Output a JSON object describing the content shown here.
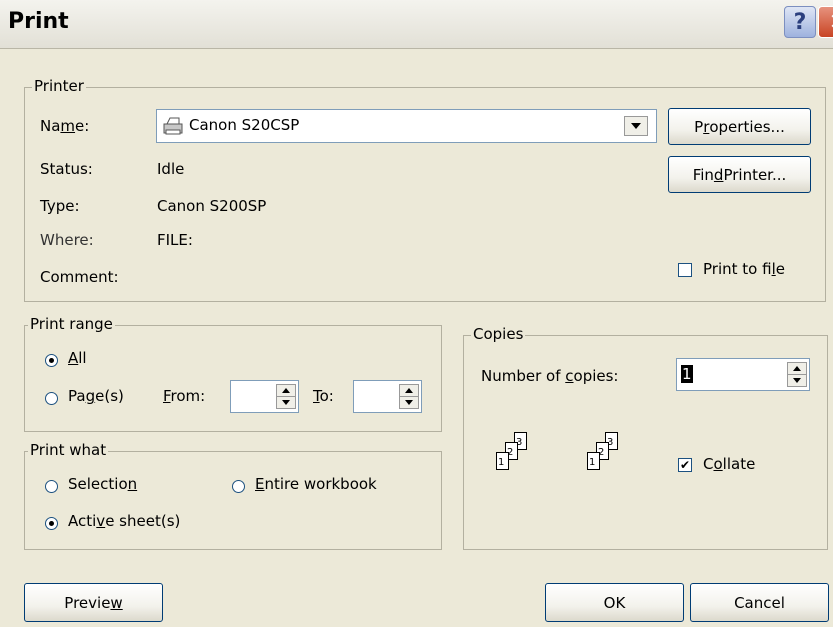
{
  "window": {
    "title": "Print",
    "help": "?",
    "close": "✕"
  },
  "printer": {
    "group_label": "Printer",
    "name_label_pre": "Na",
    "name_label_u": "m",
    "name_label_post": "e:",
    "name_value": "Canon S20CSP",
    "status_label": "Status:",
    "status_value": "Idle",
    "type_label": "Type:",
    "type_value": "Canon S200SP",
    "where_label": "Where:",
    "where_value": "FILE:",
    "comment_label": "Comment:",
    "properties_pre": "P",
    "properties_u": "r",
    "properties_post": "operties...",
    "find_pre": "Fin",
    "find_u": "d",
    "find_post": " Printer...",
    "print_to_file_pre": "Print to fi",
    "print_to_file_u": "l",
    "print_to_file_post": "e",
    "print_to_file_checked": false
  },
  "print_range": {
    "group_label": "Print range",
    "all_u": "A",
    "all_post": "ll",
    "all_selected": true,
    "pages_pre": "Pa",
    "pages_u": "g",
    "pages_post": "e(s)",
    "from_u": "F",
    "from_post": "rom:",
    "from_value": "",
    "to_u": "T",
    "to_post": "o:",
    "to_value": ""
  },
  "print_what": {
    "group_label": "Print what",
    "selection_pre": "Selectio",
    "selection_u": "n",
    "entire_u": "E",
    "entire_post": "ntire workbook",
    "active_pre": "Acti",
    "active_u": "v",
    "active_post": "e sheet(s)",
    "selected": "active"
  },
  "copies": {
    "group_label": "Copies",
    "number_pre": "Number of ",
    "number_u": "c",
    "number_post": "opies:",
    "number_value": "1",
    "collate_pre": "C",
    "collate_u": "o",
    "collate_post": "llate",
    "collate_checked": true,
    "icon_pages": [
      "1",
      "2",
      "3"
    ]
  },
  "footer": {
    "preview_pre": "Previe",
    "preview_u": "w",
    "ok": "OK",
    "cancel": "Cancel"
  }
}
